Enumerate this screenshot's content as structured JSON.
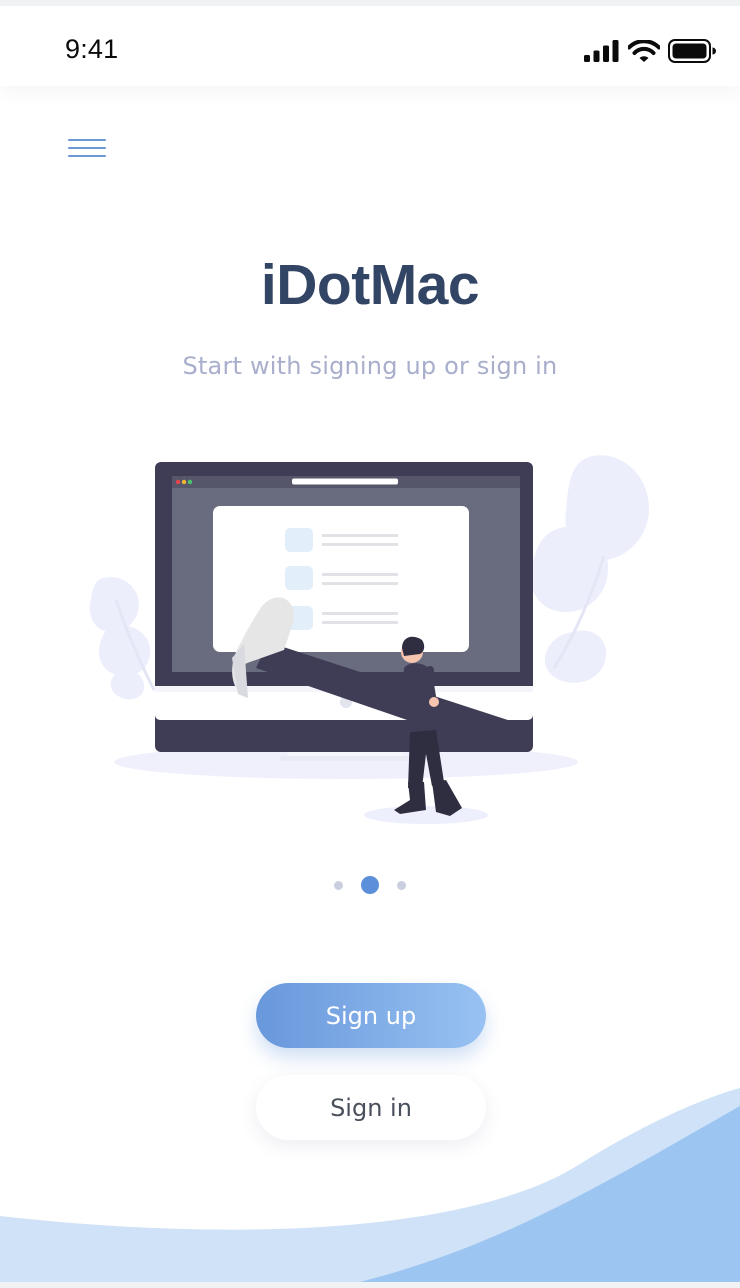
{
  "status_bar": {
    "time": "9:41",
    "icons": [
      "cellular-signal-icon",
      "wifi-icon",
      "battery-icon"
    ]
  },
  "header": {
    "menu_icon": "hamburger-menu-icon"
  },
  "main": {
    "title": "iDotMac",
    "subtitle": "Start with signing up or sign in"
  },
  "pager": {
    "count": 3,
    "active_index": 1
  },
  "actions": {
    "signup_label": "Sign up",
    "signin_label": "Sign in"
  },
  "colors": {
    "title": "#334565",
    "subtitle": "#a8aecb",
    "accent": "#5c8fd9",
    "gradient_start": "#6897db",
    "gradient_end": "#98c2f2",
    "wave_light": "#cfe2f7",
    "wave_dark": "#9cc6f1",
    "monitor_frame": "#3f3d56",
    "illustration_foliage": "#eceefc"
  }
}
